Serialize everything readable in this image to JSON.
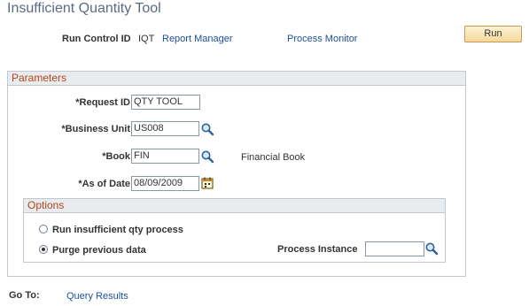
{
  "page": {
    "title": "Insufficient Quantity Tool"
  },
  "header": {
    "run_control_label": "Run Control ID",
    "run_control_value": "IQT",
    "report_manager_link": "Report Manager",
    "process_monitor_link": "Process Monitor",
    "run_button": "Run"
  },
  "parameters": {
    "title": "Parameters",
    "request_id": {
      "label": "*Request ID",
      "value": "QTY TOOL"
    },
    "business_unit": {
      "label": "*Business Unit",
      "value": "US008",
      "icon": "search-icon"
    },
    "book": {
      "label": "*Book",
      "value": "FIN",
      "icon": "search-icon",
      "description": "Financial Book"
    },
    "as_of_date": {
      "label": "*As of Date",
      "value": "08/09/2009",
      "icon": "calendar-icon"
    }
  },
  "options": {
    "title": "Options",
    "radio_run_label": "Run insufficient qty process",
    "radio_purge_label": "Purge previous data",
    "selected": "purge",
    "process_instance_label": "Process Instance",
    "process_instance_value": ""
  },
  "footer": {
    "goto_label": "Go To:",
    "query_results_link": "Query Results"
  },
  "colors": {
    "title": "#5b6a83",
    "link": "#1d4e9a",
    "group_header_text": "#b5451b",
    "run_button_bg": "#f4d99a"
  }
}
